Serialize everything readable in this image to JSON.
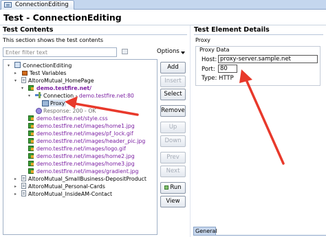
{
  "tab": {
    "label": "ConnectionEditing"
  },
  "editor": {
    "title": "Test - ConnectionEditing"
  },
  "left": {
    "section_title": "Test Contents",
    "description": "This section shows the test contents",
    "filter_placeholder": "Enter filter text",
    "options_label": "Options"
  },
  "tree": {
    "root": "ConnectionEditing",
    "test_variables": "Test Variables",
    "homepage": "AltoroMutual_HomePage",
    "demo_host": "demo.testfire.net/",
    "connection_prefix": "Connection - ",
    "connection_host": "demo.testfire.net:80",
    "proxy": "Proxy",
    "response": "Response: 200 - OK",
    "requests": [
      "demo.testfire.net/style.css",
      "demo.testfire.net/images/home1.jpg",
      "demo.testfire.net/images/pf_lock.gif",
      "demo.testfire.net/images/header_pic.jpg",
      "demo.testfire.net/images/logo.gif",
      "demo.testfire.net/images/home2.jpg",
      "demo.testfire.net/images/home3.jpg",
      "demo.testfire.net/images/gradient.jpg"
    ],
    "pages": [
      "AltoroMutual_SmallBusiness-DepositProduct",
      "AltoroMutual_Personal-Cards",
      "AltoroMutual_InsideAM-Contact"
    ]
  },
  "buttons": {
    "add": "Add",
    "insert": "Insert",
    "select": "Select",
    "remove": "Remove",
    "up": "Up",
    "down": "Down",
    "prev": "Prev",
    "next": "Next",
    "run": "Run",
    "view": "View"
  },
  "right": {
    "section_title": "Test Element Details",
    "subtitle": "Proxy",
    "group_label": "Proxy Data",
    "host_label": "Host:",
    "host_value": "proxy-server.sample.net",
    "port_label": "Port:",
    "port_value": "80",
    "type_label": "Type:",
    "type_value": "HTTP"
  },
  "bottom_tab": {
    "label": "General"
  },
  "colors": {
    "accent_red": "#e8392b",
    "link_purple": "#7b1fa2",
    "tab_blue": "#c4d6ee"
  }
}
